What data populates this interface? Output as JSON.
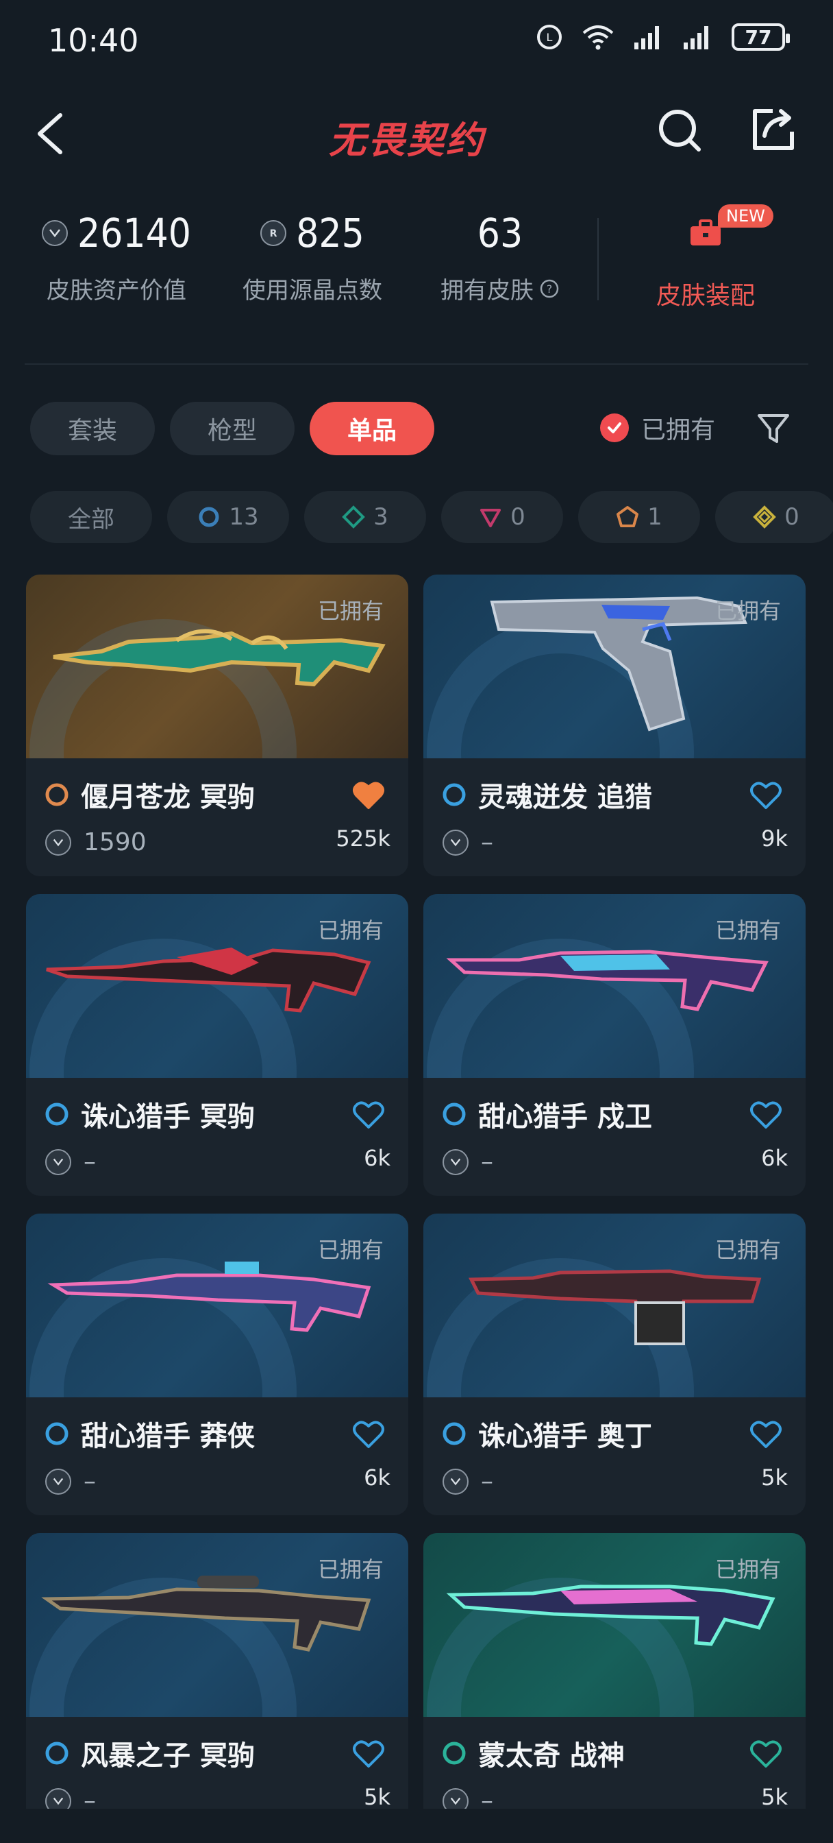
{
  "status": {
    "time": "10:40",
    "battery": "77"
  },
  "nav": {
    "title": "无畏契约"
  },
  "stats": {
    "asset_value": {
      "value": "26140",
      "label": "皮肤资产价值"
    },
    "radianite": {
      "value": "825",
      "label": "使用源晶点数"
    },
    "owned": {
      "value": "63",
      "label": "拥有皮肤"
    },
    "equip": {
      "label": "皮肤装配",
      "badge": "NEW"
    }
  },
  "tabs": [
    {
      "label": "套装"
    },
    {
      "label": "枪型"
    },
    {
      "label": "单品"
    }
  ],
  "owned_filter": {
    "label": "已拥有"
  },
  "chips": [
    {
      "label": "全部",
      "icon": "all"
    },
    {
      "label": "13",
      "icon": "select-tier-icon",
      "color": "#3b7fb8"
    },
    {
      "label": "3",
      "icon": "deluxe-tier-icon",
      "color": "#1f9a83"
    },
    {
      "label": "0",
      "icon": "premium-tier-icon",
      "color": "#c33a6b"
    },
    {
      "label": "1",
      "icon": "exclusive-tier-icon",
      "color": "#d9864a"
    },
    {
      "label": "0",
      "icon": "ultra-tier-icon",
      "color": "#c9b23c"
    }
  ],
  "skins": [
    {
      "name": "偃月苍龙 冥驹",
      "owned": "已拥有",
      "price": "1590",
      "likes": "525k",
      "tier_color": "#e08a4e",
      "heart_filled": true,
      "heart_color": "#f08040",
      "bg": "gold"
    },
    {
      "name": "灵魂迸发 追猎",
      "owned": "已拥有",
      "price": "–",
      "likes": "9k",
      "tier_color": "#3aa0e0",
      "heart_filled": false,
      "heart_color": "#3aa0e0",
      "bg": "blue"
    },
    {
      "name": "诛心猎手 冥驹",
      "owned": "已拥有",
      "price": "–",
      "likes": "6k",
      "tier_color": "#3aa0e0",
      "heart_filled": false,
      "heart_color": "#3aa0e0",
      "bg": "blue"
    },
    {
      "name": "甜心猎手 戍卫",
      "owned": "已拥有",
      "price": "–",
      "likes": "6k",
      "tier_color": "#3aa0e0",
      "heart_filled": false,
      "heart_color": "#3aa0e0",
      "bg": "blue"
    },
    {
      "name": "甜心猎手 莽侠",
      "owned": "已拥有",
      "price": "–",
      "likes": "6k",
      "tier_color": "#3aa0e0",
      "heart_filled": false,
      "heart_color": "#3aa0e0",
      "bg": "blue"
    },
    {
      "name": "诛心猎手 奥丁",
      "owned": "已拥有",
      "price": "–",
      "likes": "5k",
      "tier_color": "#3aa0e0",
      "heart_filled": false,
      "heart_color": "#3aa0e0",
      "bg": "blue"
    },
    {
      "name": "风暴之子 冥驹",
      "owned": "已拥有",
      "price": "–",
      "likes": "5k",
      "tier_color": "#3aa0e0",
      "heart_filled": false,
      "heart_color": "#3aa0e0",
      "bg": "blue"
    },
    {
      "name": "蒙太奇 战神",
      "owned": "已拥有",
      "price": "–",
      "likes": "5k",
      "tier_color": "#2bb39a",
      "heart_filled": false,
      "heart_color": "#2bb39a",
      "bg": "teal"
    }
  ]
}
